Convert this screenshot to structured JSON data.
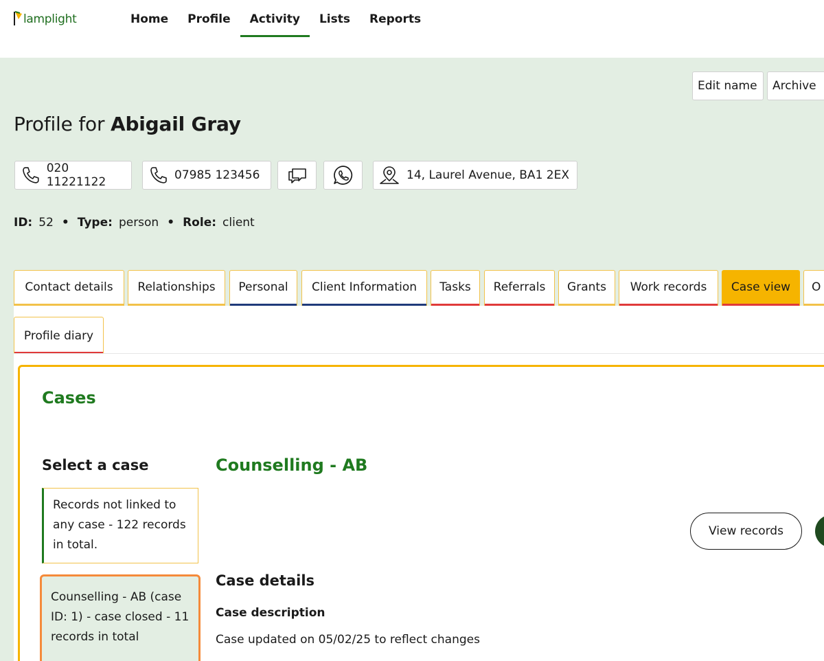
{
  "app": {
    "logo_text": "lamplight"
  },
  "nav": {
    "items": [
      {
        "label": "Home"
      },
      {
        "label": "Profile"
      },
      {
        "label": "Activity",
        "active": true
      },
      {
        "label": "Lists"
      },
      {
        "label": "Reports"
      }
    ]
  },
  "actions": {
    "edit_name": "Edit name",
    "archive": "Archive"
  },
  "profile": {
    "title_prefix": "Profile for",
    "name": "Abigail Gray",
    "phone1": "020 11221122",
    "phone2": "07985 123456",
    "address": "14, Laurel Avenue, BA1 2EX",
    "id_label": "ID:",
    "id_value": "52",
    "type_label": "Type:",
    "type_value": "person",
    "role_label": "Role:",
    "role_value": "client",
    "separator": "•"
  },
  "tabs": [
    {
      "label": "Contact details"
    },
    {
      "label": "Relationships"
    },
    {
      "label": "Personal"
    },
    {
      "label": "Client Information"
    },
    {
      "label": "Tasks"
    },
    {
      "label": "Referrals"
    },
    {
      "label": "Grants"
    },
    {
      "label": "Work records"
    },
    {
      "label": "Case view",
      "active": true
    },
    {
      "label": "O"
    },
    {
      "label": "Profile diary"
    }
  ],
  "cases": {
    "title": "Cases",
    "select_heading": "Select a case",
    "list": [
      {
        "text": "Records not linked to any case - 122 records in total."
      },
      {
        "text": "Counselling - AB (case ID: 1) - case closed - 11 records in total",
        "selected": true
      }
    ],
    "selected_title": "Counselling - AB",
    "view_records": "View records",
    "details_heading": "Case details",
    "description_heading": "Case description",
    "description": "Case updated on 05/02/25 to reflect changes"
  },
  "colors": {
    "brand_green": "#1f7a1f",
    "header_bg": "#e3eee3",
    "active_tab": "#f6b400",
    "tab_border": "#f2c24a",
    "selected_case_border": "#f58a3a"
  },
  "icons": [
    "lamp-icon",
    "phone-icon",
    "chat-icon",
    "whatsapp-icon",
    "map-pin-icon"
  ]
}
